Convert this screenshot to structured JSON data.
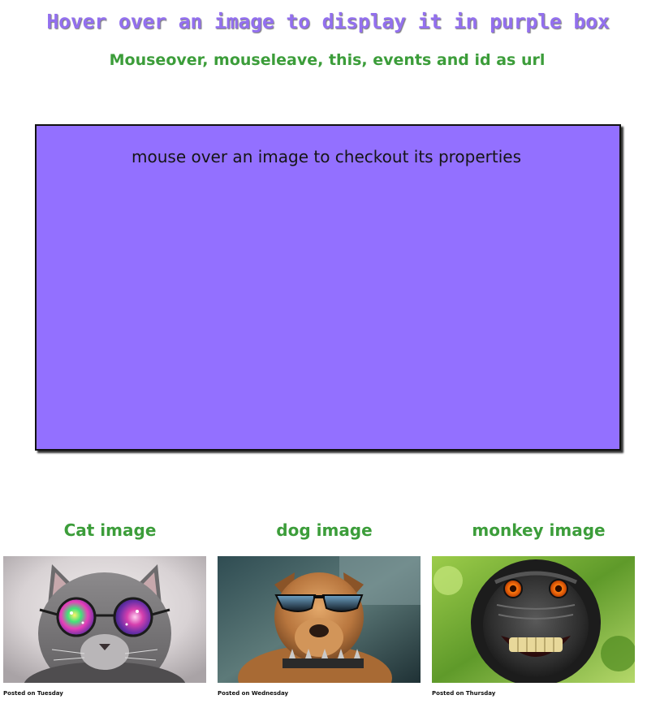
{
  "header": {
    "title": "Hover over an image to display it in purple box",
    "subtitle": "Mouseover, mouseleave, this, events and id as url"
  },
  "display_box": {
    "text": "mouse over an image to checkout its properties",
    "color": "#9370ff"
  },
  "gallery": {
    "items": [
      {
        "caption": "Cat image",
        "posted": "Posted on Tuesday",
        "image": "cat-with-rainbow-glasses"
      },
      {
        "caption": "dog image",
        "posted": "Posted on Wednesday",
        "image": "dog-with-sunglasses"
      },
      {
        "caption": "monkey image",
        "posted": "Posted on Thursday",
        "image": "grinning-macaque"
      }
    ]
  },
  "colors": {
    "title": "#9370ee",
    "subtitle": "#3c9d3a",
    "caption": "#3c9d3a"
  }
}
